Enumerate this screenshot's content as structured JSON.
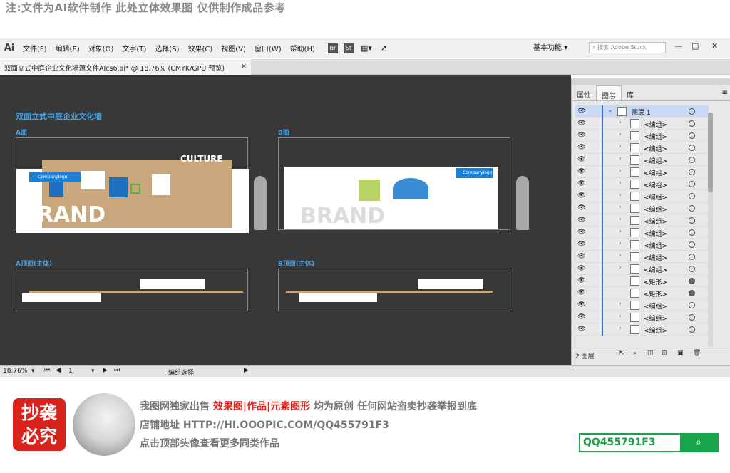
{
  "top_note": "注:文件为AI软件制作 此处立体效果图 仅供制作成品参考",
  "menubar": {
    "logo": "Ai",
    "items": [
      "文件(F)",
      "编辑(E)",
      "对象(O)",
      "文字(T)",
      "选择(S)",
      "效果(C)",
      "视图(V)",
      "窗口(W)",
      "帮助(H)"
    ],
    "app_btn1": "Br",
    "app_btn2": "St",
    "workspace": "基本功能",
    "search_placeholder": "搜索 Adobe Stock",
    "win_min": "—",
    "win_max": "□",
    "win_close": "✕"
  },
  "doc_tab": {
    "title": "双面立式中庭企业文化墙源文件AIcs6.ai* @ 18.76% (CMYK/GPU 预览)",
    "close": "✕"
  },
  "canvas": {
    "title": "双面立式中庭企业文化墙",
    "label_a": "A面",
    "label_b": "B面",
    "label_a_top": "A顶面(主体)",
    "label_b_top": "B顶面(主体)",
    "logo_text": "Companylogo",
    "brand": "BRAND",
    "culture": "CULTURE"
  },
  "panel": {
    "tabs": [
      "属性",
      "图层",
      "库"
    ],
    "active_tab": "图层",
    "layer_top": "图层 1",
    "layers": [
      {
        "name": "<编组>",
        "chev": true,
        "filled": false
      },
      {
        "name": "<编组>",
        "chev": true,
        "filled": false
      },
      {
        "name": "<编组>",
        "chev": true,
        "filled": false
      },
      {
        "name": "<编组>",
        "chev": true,
        "filled": false
      },
      {
        "name": "<编组>",
        "chev": true,
        "filled": false
      },
      {
        "name": "<编组>",
        "chev": true,
        "filled": false
      },
      {
        "name": "<编组>",
        "chev": true,
        "filled": false
      },
      {
        "name": "<编组>",
        "chev": true,
        "filled": false
      },
      {
        "name": "<编组>",
        "chev": true,
        "filled": false
      },
      {
        "name": "<编组>",
        "chev": true,
        "filled": false
      },
      {
        "name": "<编组>",
        "chev": true,
        "filled": false
      },
      {
        "name": "<编组>",
        "chev": true,
        "filled": false
      },
      {
        "name": "<编组>",
        "chev": true,
        "filled": false
      },
      {
        "name": "<矩形>",
        "chev": false,
        "filled": true
      },
      {
        "name": "<矩形>",
        "chev": false,
        "filled": true
      },
      {
        "name": "<编组>",
        "chev": true,
        "filled": false
      },
      {
        "name": "<编组>",
        "chev": true,
        "filled": false
      },
      {
        "name": "<编组>",
        "chev": true,
        "filled": false
      }
    ],
    "bottom_label": "2 图层"
  },
  "status": {
    "zoom": "18.76%",
    "page": "1",
    "tool": "编组选择"
  },
  "footer": {
    "stamp_line1": "抄袭",
    "stamp_line2": "必究",
    "line1_prefix": "我图网独家出售 ",
    "line1_red": "效果图|作品|元素图形",
    "line1_suffix": " 均为原创 任何网站盗卖抄袭举报到底",
    "line2": "店铺地址 HTTP://HI.OOOPIC.COM/QQ455791F3",
    "line3": "点击顶部头像查看更多同类作品",
    "qq": "QQ455791F3"
  },
  "colors": {
    "accent_blue": "#3fa3e8",
    "canvas_bg": "#383838",
    "brand_red": "#d9231c",
    "qq_green": "#1aa44a"
  }
}
